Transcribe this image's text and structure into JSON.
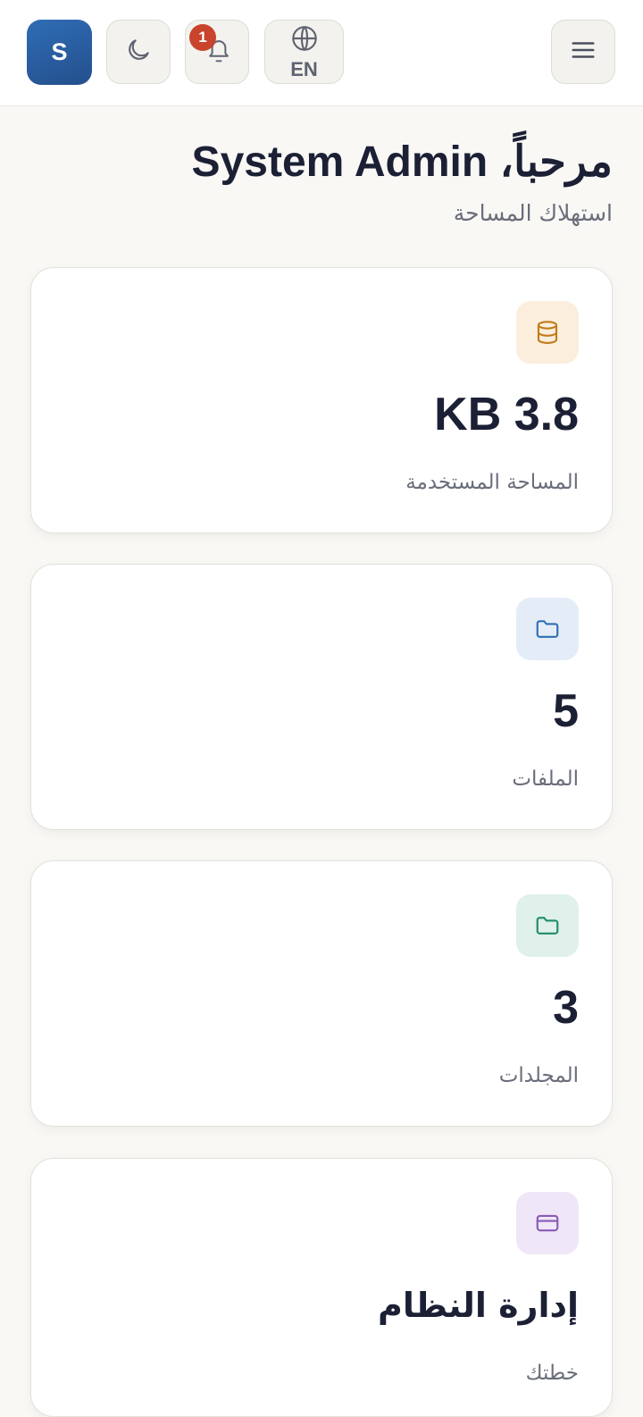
{
  "header": {
    "avatar_initial": "S",
    "theme_toggle_icon": "moon-icon",
    "notifications_icon": "bell-icon",
    "notification_count": "1",
    "language_icon": "globe-icon",
    "language_label": "EN",
    "menu_icon": "hamburger-menu-icon"
  },
  "main": {
    "greeting": "مرحباً، System Admin",
    "subtitle": "استهلاك المساحة"
  },
  "stats": [
    {
      "icon": "database-icon",
      "value": "KB 3.8",
      "label": "المساحة المستخدمة",
      "icon_color": "#c17c1a",
      "icon_bg": "#fbeedd"
    },
    {
      "icon": "folder-icon",
      "value": "5",
      "label": "الملفات",
      "icon_color": "#2f6db5",
      "icon_bg": "#e4edf7"
    },
    {
      "icon": "folder-icon",
      "value": "3",
      "label": "المجلدات",
      "icon_color": "#1e8a6a",
      "icon_bg": "#dff1ea"
    },
    {
      "icon": "credit-card-icon",
      "value": "إدارة النظام",
      "label": "خطتك",
      "icon_color": "#8a5bb8",
      "icon_bg": "#efe6f7"
    }
  ],
  "colors": {
    "accent": "#2f6db5",
    "badge": "#c8442c",
    "background": "#f9f8f5",
    "text": "#1c2035",
    "muted_text": "#6a6d7a"
  }
}
